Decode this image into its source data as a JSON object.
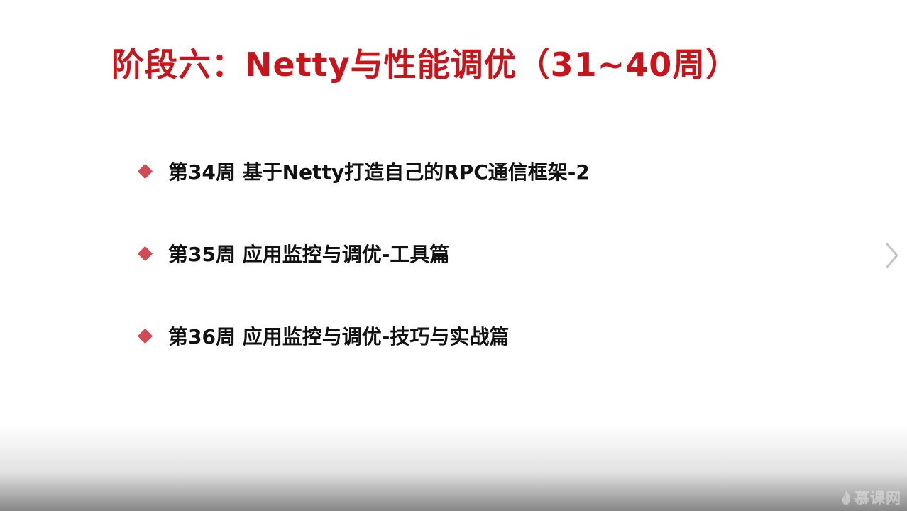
{
  "slide": {
    "title": "阶段六：Netty与性能调优（31~40周）",
    "bullets": [
      "第34周 基于Netty打造自己的RPC通信框架-2",
      "第35周 应用监控与调优-工具篇",
      "第36周 应用监控与调优-技巧与实战篇"
    ]
  },
  "navigation": {
    "next_icon": "chevron-right-icon"
  },
  "watermark": {
    "text": "慕课网",
    "icon": "flame-icon"
  },
  "colors": {
    "title": "#c8141a",
    "bullet_marker": "#d24a55",
    "bullet_text": "#111111"
  }
}
